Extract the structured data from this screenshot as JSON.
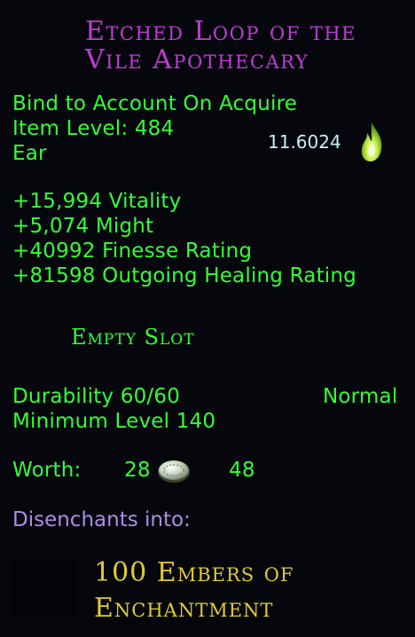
{
  "item": {
    "name_line1": "Etched Loop of the",
    "name_line2": "Vile Apothecary",
    "bind": "Bind to Account On Acquire",
    "item_level": "Item Level: 484",
    "slot": "Ear",
    "value": "11.6024",
    "stats": [
      "+15,994 Vitality",
      "+5,074 Might",
      "+40992 Finesse Rating",
      "+81598 Outgoing Healing Rating"
    ],
    "empty_slot": "Empty Slot",
    "durability": "Durability 60/60",
    "durability_type": "Normal",
    "min_level": "Minimum Level 140",
    "worth_label": "Worth:",
    "worth_gold": "28",
    "worth_silver": "48",
    "disenchant_label": "Disenchants into:",
    "disenchant_line1": "100 Embers of",
    "disenchant_line2": "Enchantment"
  },
  "colors": {
    "title": "#c23ad6",
    "stat_text": "#34ff34",
    "value_text": "#c7f0f6",
    "disenchant_label": "#b08ae6",
    "disenchant_result": "#e3cb2c"
  },
  "icons": {
    "value": "green-flame-icon",
    "currency": "coin-icon"
  }
}
